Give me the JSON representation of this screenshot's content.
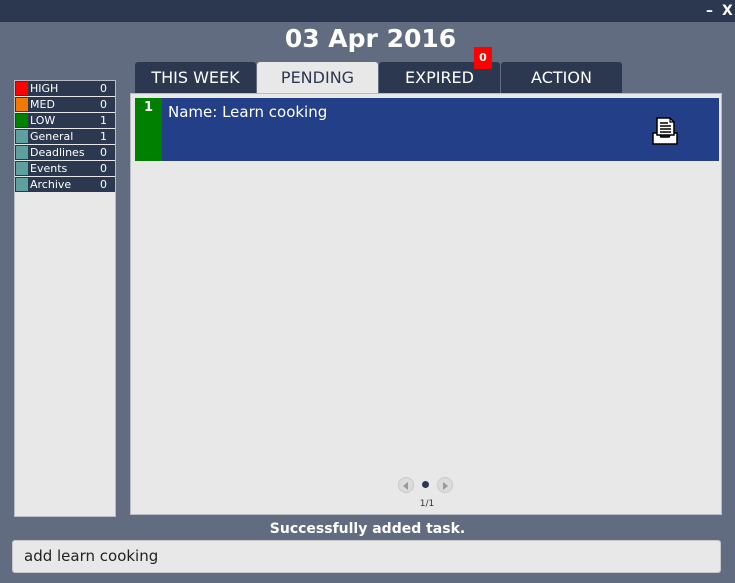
{
  "window": {
    "minimize_label": "–",
    "close_label": "X"
  },
  "header": {
    "date": "03 Apr 2016"
  },
  "sidebar": {
    "categories": [
      {
        "label": "HIGH",
        "count": "0",
        "color": "#ff0000"
      },
      {
        "label": "MED",
        "count": "0",
        "color": "#f07a00"
      },
      {
        "label": "LOW",
        "count": "1",
        "color": "#008000"
      },
      {
        "label": "General",
        "count": "1",
        "color": "#5f9fa0"
      },
      {
        "label": "Deadlines",
        "count": "0",
        "color": "#5f9fa0"
      },
      {
        "label": "Events",
        "count": "0",
        "color": "#5f9fa0"
      },
      {
        "label": "Archive",
        "count": "0",
        "color": "#5f9fa0"
      }
    ]
  },
  "tabs": [
    {
      "label": "THIS WEEK",
      "active": false
    },
    {
      "label": "PENDING",
      "active": true
    },
    {
      "label": "EXPIRED",
      "active": false,
      "badge": "0"
    },
    {
      "label": "ACTION",
      "active": false
    }
  ],
  "tasks": [
    {
      "index": "1",
      "name": "Name: Learn cooking",
      "priority_color": "#008000",
      "icon": "document-icon"
    }
  ],
  "pager": {
    "page_text": "1/1"
  },
  "status": {
    "message": "Successfully added task."
  },
  "command": {
    "value": "add learn cooking"
  }
}
